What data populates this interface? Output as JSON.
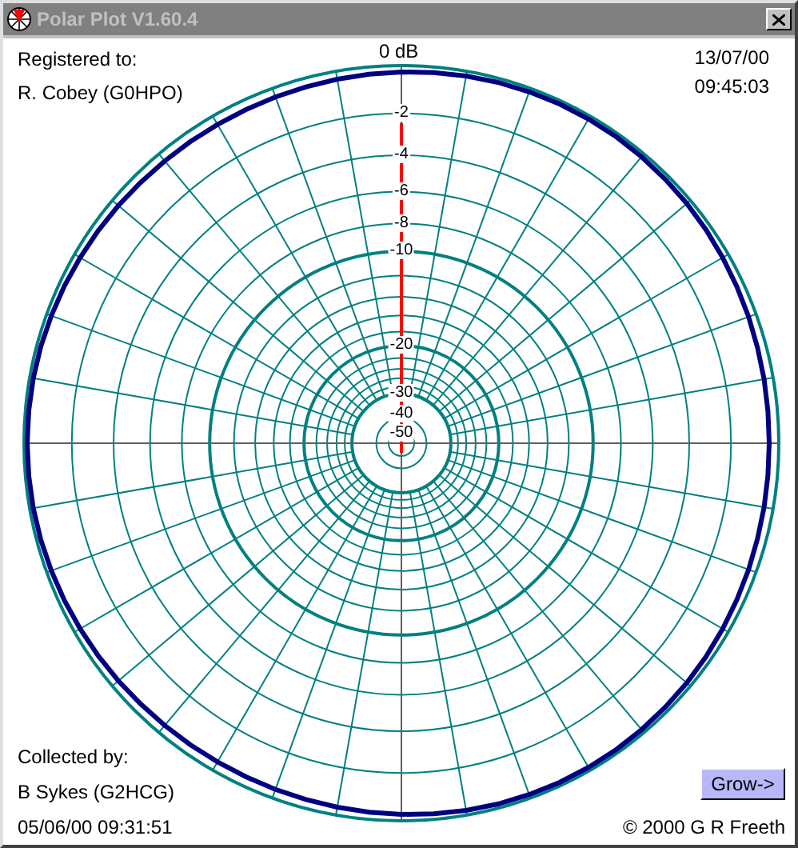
{
  "window": {
    "title": "Polar Plot V1.60.4"
  },
  "registered": {
    "label": "Registered to:",
    "name": "R. Cobey (G0HPO)"
  },
  "reference": "0 dB",
  "timestamp": {
    "date": "13/07/00",
    "time": "09:45:03"
  },
  "ring_labels": [
    "-2",
    "-4",
    "-6",
    "-8",
    "-10",
    "-20",
    "-30",
    "-40",
    "-50"
  ],
  "collected": {
    "label": "Collected by:",
    "name": "B Sykes (G2HCG)",
    "datetime": "05/06/00 09:31:51"
  },
  "grow_button": "Grow->",
  "copyright": "© 2000  G R Freeth"
}
